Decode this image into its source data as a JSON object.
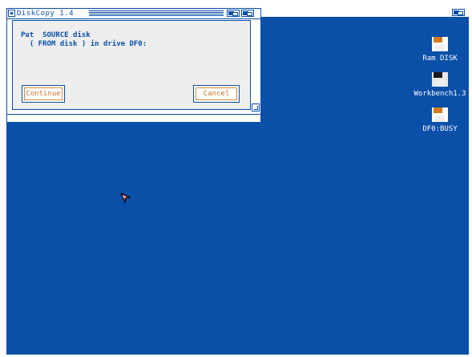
{
  "window": {
    "title": "DiskCopy 1.4",
    "message_line1": "Put  SOURCE disk",
    "message_line2": "  ( FROM disk ) in drive DF0:",
    "continue_label": "Continue",
    "cancel_label": "Cancel"
  },
  "desktop": {
    "icons": [
      {
        "label": "Ram DISK",
        "icon": "ram-disk-icon"
      },
      {
        "label": "Workbench1.3",
        "icon": "workbench-disk-icon"
      },
      {
        "label": "DF0:BUSY",
        "icon": "floppy-disk-icon"
      }
    ]
  },
  "colors": {
    "screen_background": "#0a4fa8",
    "accent": "#c8742e",
    "text": "#ffffff"
  }
}
